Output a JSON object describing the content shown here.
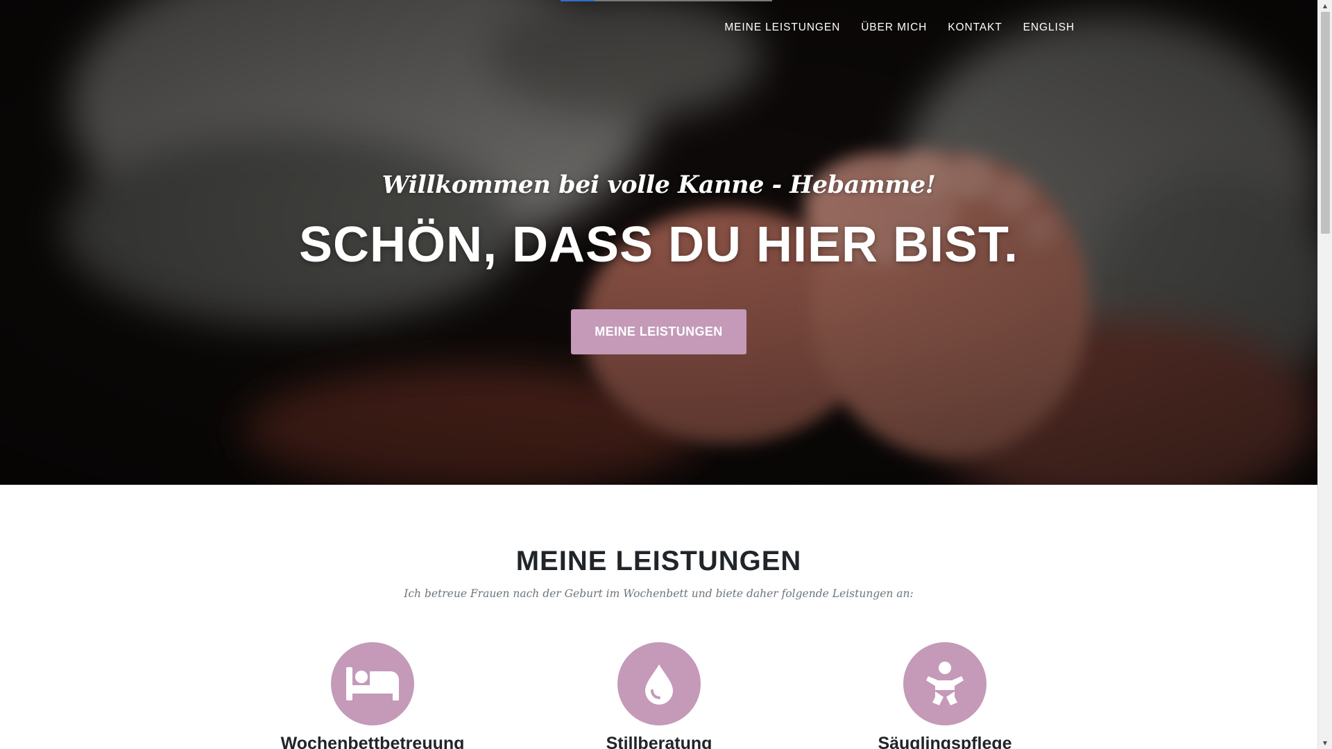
{
  "nav": {
    "links": [
      "MEINE LEISTUNGEN",
      "ÜBER MICH",
      "KONTAKT",
      "ENGLISH"
    ]
  },
  "page_progress": 0.16,
  "hero": {
    "subtitle": "Willkommen bei volle Kanne - Hebamme!",
    "title": "SCHÖN, DASS DU HIER BIST.",
    "button_label": "MEINE LEISTUNGEN"
  },
  "services": {
    "title": "MEINE LEISTUNGEN",
    "lead": "Ich betreue Frauen nach der Geburt im Wochenbett und biete daher folgende Leistungen an:",
    "items": [
      {
        "name": "Wochenbettbetreuung",
        "icon": "bed-icon"
      },
      {
        "name": "Stillberatung",
        "icon": "drop-icon"
      },
      {
        "name": "Säuglingspflege",
        "icon": "baby-icon"
      }
    ]
  },
  "colors": {
    "accent": "#c49ab8",
    "heading": "#212529",
    "muted": "#6c757d",
    "nav_text": "#ffffff"
  }
}
